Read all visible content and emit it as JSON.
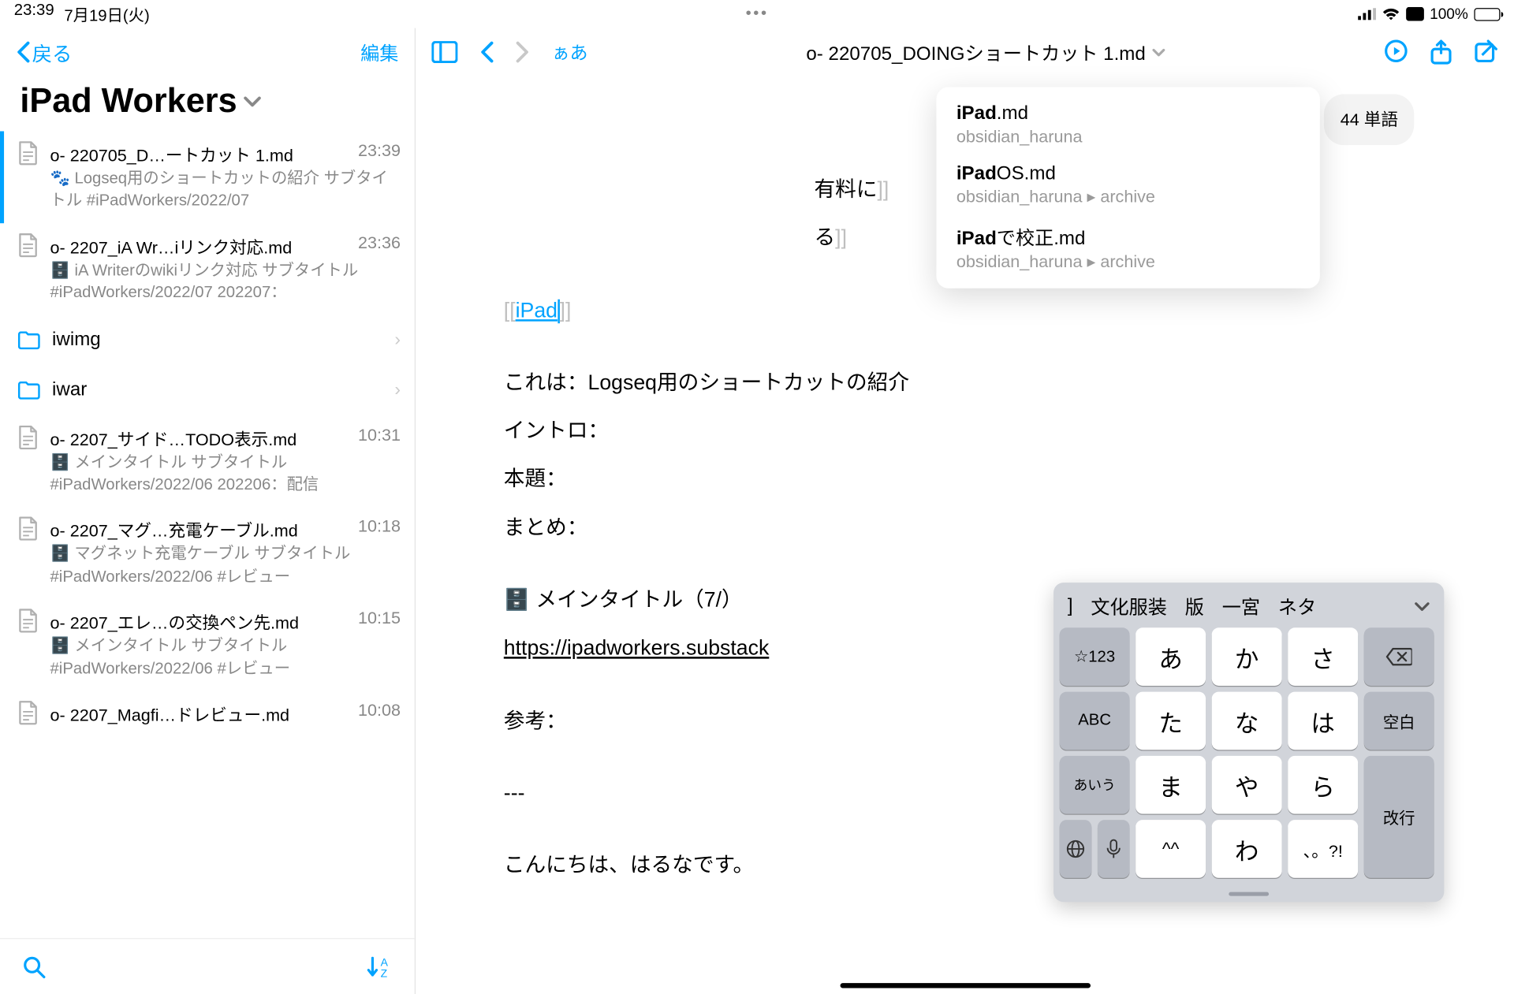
{
  "status": {
    "time": "23:39",
    "date": "7月19日(火)",
    "battery": "100%",
    "ellipsis": "•••"
  },
  "sidebar": {
    "back": "戻る",
    "edit": "編集",
    "title": "iPad Workers",
    "items": [
      {
        "title": "o- 220705_D…ートカット 1.md",
        "time": "23:39",
        "sub": "🐾 Logseq用のショートカットの紹介 サブタイトル #iPadWorkers/2022/07",
        "type": "doc",
        "selected": true
      },
      {
        "title": "o- 2207_iA Wr…iリンク対応.md",
        "time": "23:36",
        "sub": "🗄️ iA Writerのwikiリンク対応 サブタイトル #iPadWorkers/2022/07 202207：",
        "type": "doc"
      },
      {
        "title": "iwimg",
        "type": "folder"
      },
      {
        "title": "iwar",
        "type": "folder"
      },
      {
        "title": "o- 2207_サイド…TODO表示.md",
        "time": "10:31",
        "sub": "🗄️ メインタイトル サブタイトル #iPadWorkers/2022/06 202206：配信",
        "type": "doc"
      },
      {
        "title": "o- 2207_マグ…充電ケーブル.md",
        "time": "10:18",
        "sub": "🗄️ マグネット充電ケーブル サブタイトル #iPadWorkers/2022/06 #レビュー",
        "type": "doc"
      },
      {
        "title": "o- 2207_エレ…の交換ペン先.md",
        "time": "10:15",
        "sub": "🗄️ メインタイトル サブタイトル #iPadWorkers/2022/06 #レビュー",
        "type": "doc"
      },
      {
        "title": "o- 2207_Magfi…ドレビュー.md",
        "time": "10:08",
        "sub": "",
        "type": "doc"
      }
    ]
  },
  "editor": {
    "title": "o- 220705_DOINGショートカット 1.md",
    "aa": "ぁあ",
    "wordcount": "44 単語",
    "peek1": "有料に",
    "peek2": "る",
    "wikilink": "iPad",
    "line_koreha": "これは：Logseq用のショートカットの紹介",
    "line_intro": "イントロ：",
    "line_hondai": "本題：",
    "line_matome": "まとめ：",
    "line_maintitle": "🗄️ メインタイトル（7/）",
    "url": "https://ipadworkers.substack",
    "line_sankou": "参考：",
    "line_dashes": "---",
    "line_hello": "こんにちは、はるなです。"
  },
  "dropdown": [
    {
      "title_bold": "iPad",
      "title_rest": ".md",
      "path": "obsidian_haruna"
    },
    {
      "title_bold": "iPad",
      "title_rest": "OS.md",
      "path": "obsidian_haruna ▸ archive"
    },
    {
      "title_bold": "iPad",
      "title_rest": "で校正.md",
      "path": "obsidian_haruna ▸ archive"
    }
  ],
  "keyboard": {
    "suggestions": [
      "]",
      "文化服装",
      "版",
      "一宮",
      "ネタ"
    ],
    "rows": [
      [
        "☆123",
        "あ",
        "か",
        "さ",
        "⌫"
      ],
      [
        "ABC",
        "た",
        "な",
        "は",
        "空白"
      ],
      [
        "あいう",
        "ま",
        "や",
        "ら",
        "改行"
      ],
      [
        "",
        "^^",
        "わ",
        "、。?!",
        ""
      ]
    ],
    "globe": "🌐",
    "mic": "🎤"
  }
}
